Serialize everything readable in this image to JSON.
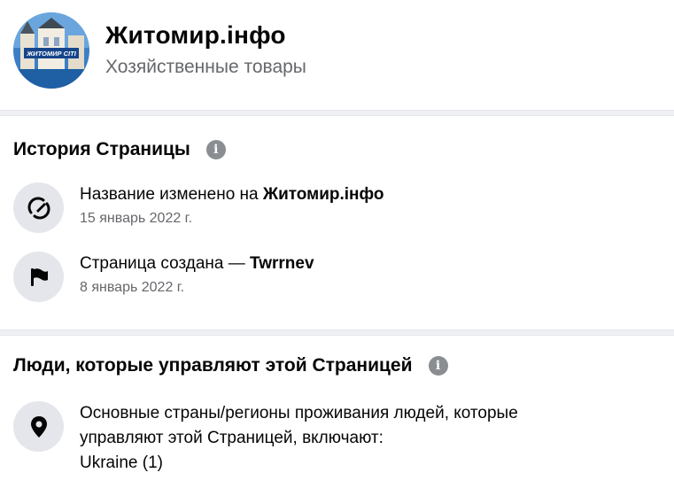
{
  "header": {
    "page_name": "Житомир.інфо",
    "category": "Хозяйственные товары",
    "avatar_text": "ЖИТОМИР СІТІ"
  },
  "history": {
    "title": "История Страницы",
    "items": [
      {
        "icon": "name-change-icon",
        "text_prefix": "Название изменено на ",
        "text_bold": "Житомир.інфо",
        "date": "15 январь 2022 г."
      },
      {
        "icon": "flag-icon",
        "text_prefix": "Страница создана — ",
        "text_bold": "Twrrnev",
        "date": "8 январь 2022 г."
      }
    ]
  },
  "people": {
    "title": "Люди, которые управляют этой Страницей",
    "item": {
      "icon": "location-pin-icon",
      "line1": "Основные страны/регионы проживания людей, которые",
      "line2": "управляют этой Страницей, включают:",
      "line3": "Ukraine (1)"
    }
  },
  "colors": {
    "secondary_text": "#65676b",
    "icon_bg": "#e4e6eb",
    "divider": "#eef0f3"
  }
}
